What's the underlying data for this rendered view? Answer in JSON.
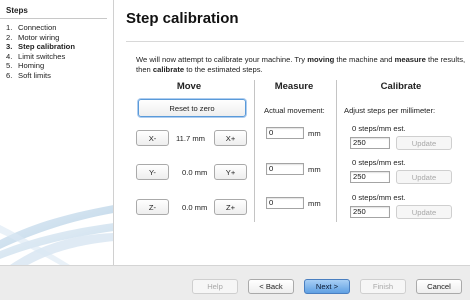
{
  "sidebar": {
    "heading": "Steps",
    "steps": [
      {
        "num": "1.",
        "label": "Connection"
      },
      {
        "num": "2.",
        "label": "Motor wiring"
      },
      {
        "num": "3.",
        "label": "Step calibration",
        "active": true
      },
      {
        "num": "4.",
        "label": "Limit switches"
      },
      {
        "num": "5.",
        "label": "Homing"
      },
      {
        "num": "6.",
        "label": "Soft limits"
      }
    ]
  },
  "main": {
    "title": "Step calibration",
    "intro": {
      "p1": "We will now attempt to calibrate your machine. Try ",
      "b1": "moving",
      "p2": " the machine and ",
      "b2": "measure",
      "p3": " the results, then ",
      "b3": "calibrate",
      "p4": " to the estimated steps."
    },
    "move": {
      "heading": "Move",
      "reset_label": "Reset to zero",
      "axes": [
        {
          "minus": "X-",
          "plus": "X+",
          "value": "11.7 mm"
        },
        {
          "minus": "Y-",
          "plus": "Y+",
          "value": "0.0 mm"
        },
        {
          "minus": "Z-",
          "plus": "Z+",
          "value": "0.0 mm"
        }
      ]
    },
    "measure": {
      "heading": "Measure",
      "subheading": "Actual movement:",
      "unit": "mm",
      "fields": [
        "0",
        "0",
        "0"
      ]
    },
    "calibrate": {
      "heading": "Calibrate",
      "subheading": "Adjust steps per millimeter:",
      "rows": [
        {
          "estimate": "0 steps/mm est.",
          "value": "250",
          "update": "Update"
        },
        {
          "estimate": "0 steps/mm est.",
          "value": "250",
          "update": "Update"
        },
        {
          "estimate": "0 steps/mm est.",
          "value": "250",
          "update": "Update"
        }
      ]
    }
  },
  "footer": {
    "help": "Help",
    "back": "< Back",
    "next": "Next >",
    "finish": "Finish",
    "cancel": "Cancel"
  },
  "colors": {
    "accent": "#5fa0e3",
    "focus": "#5a9ad9"
  }
}
